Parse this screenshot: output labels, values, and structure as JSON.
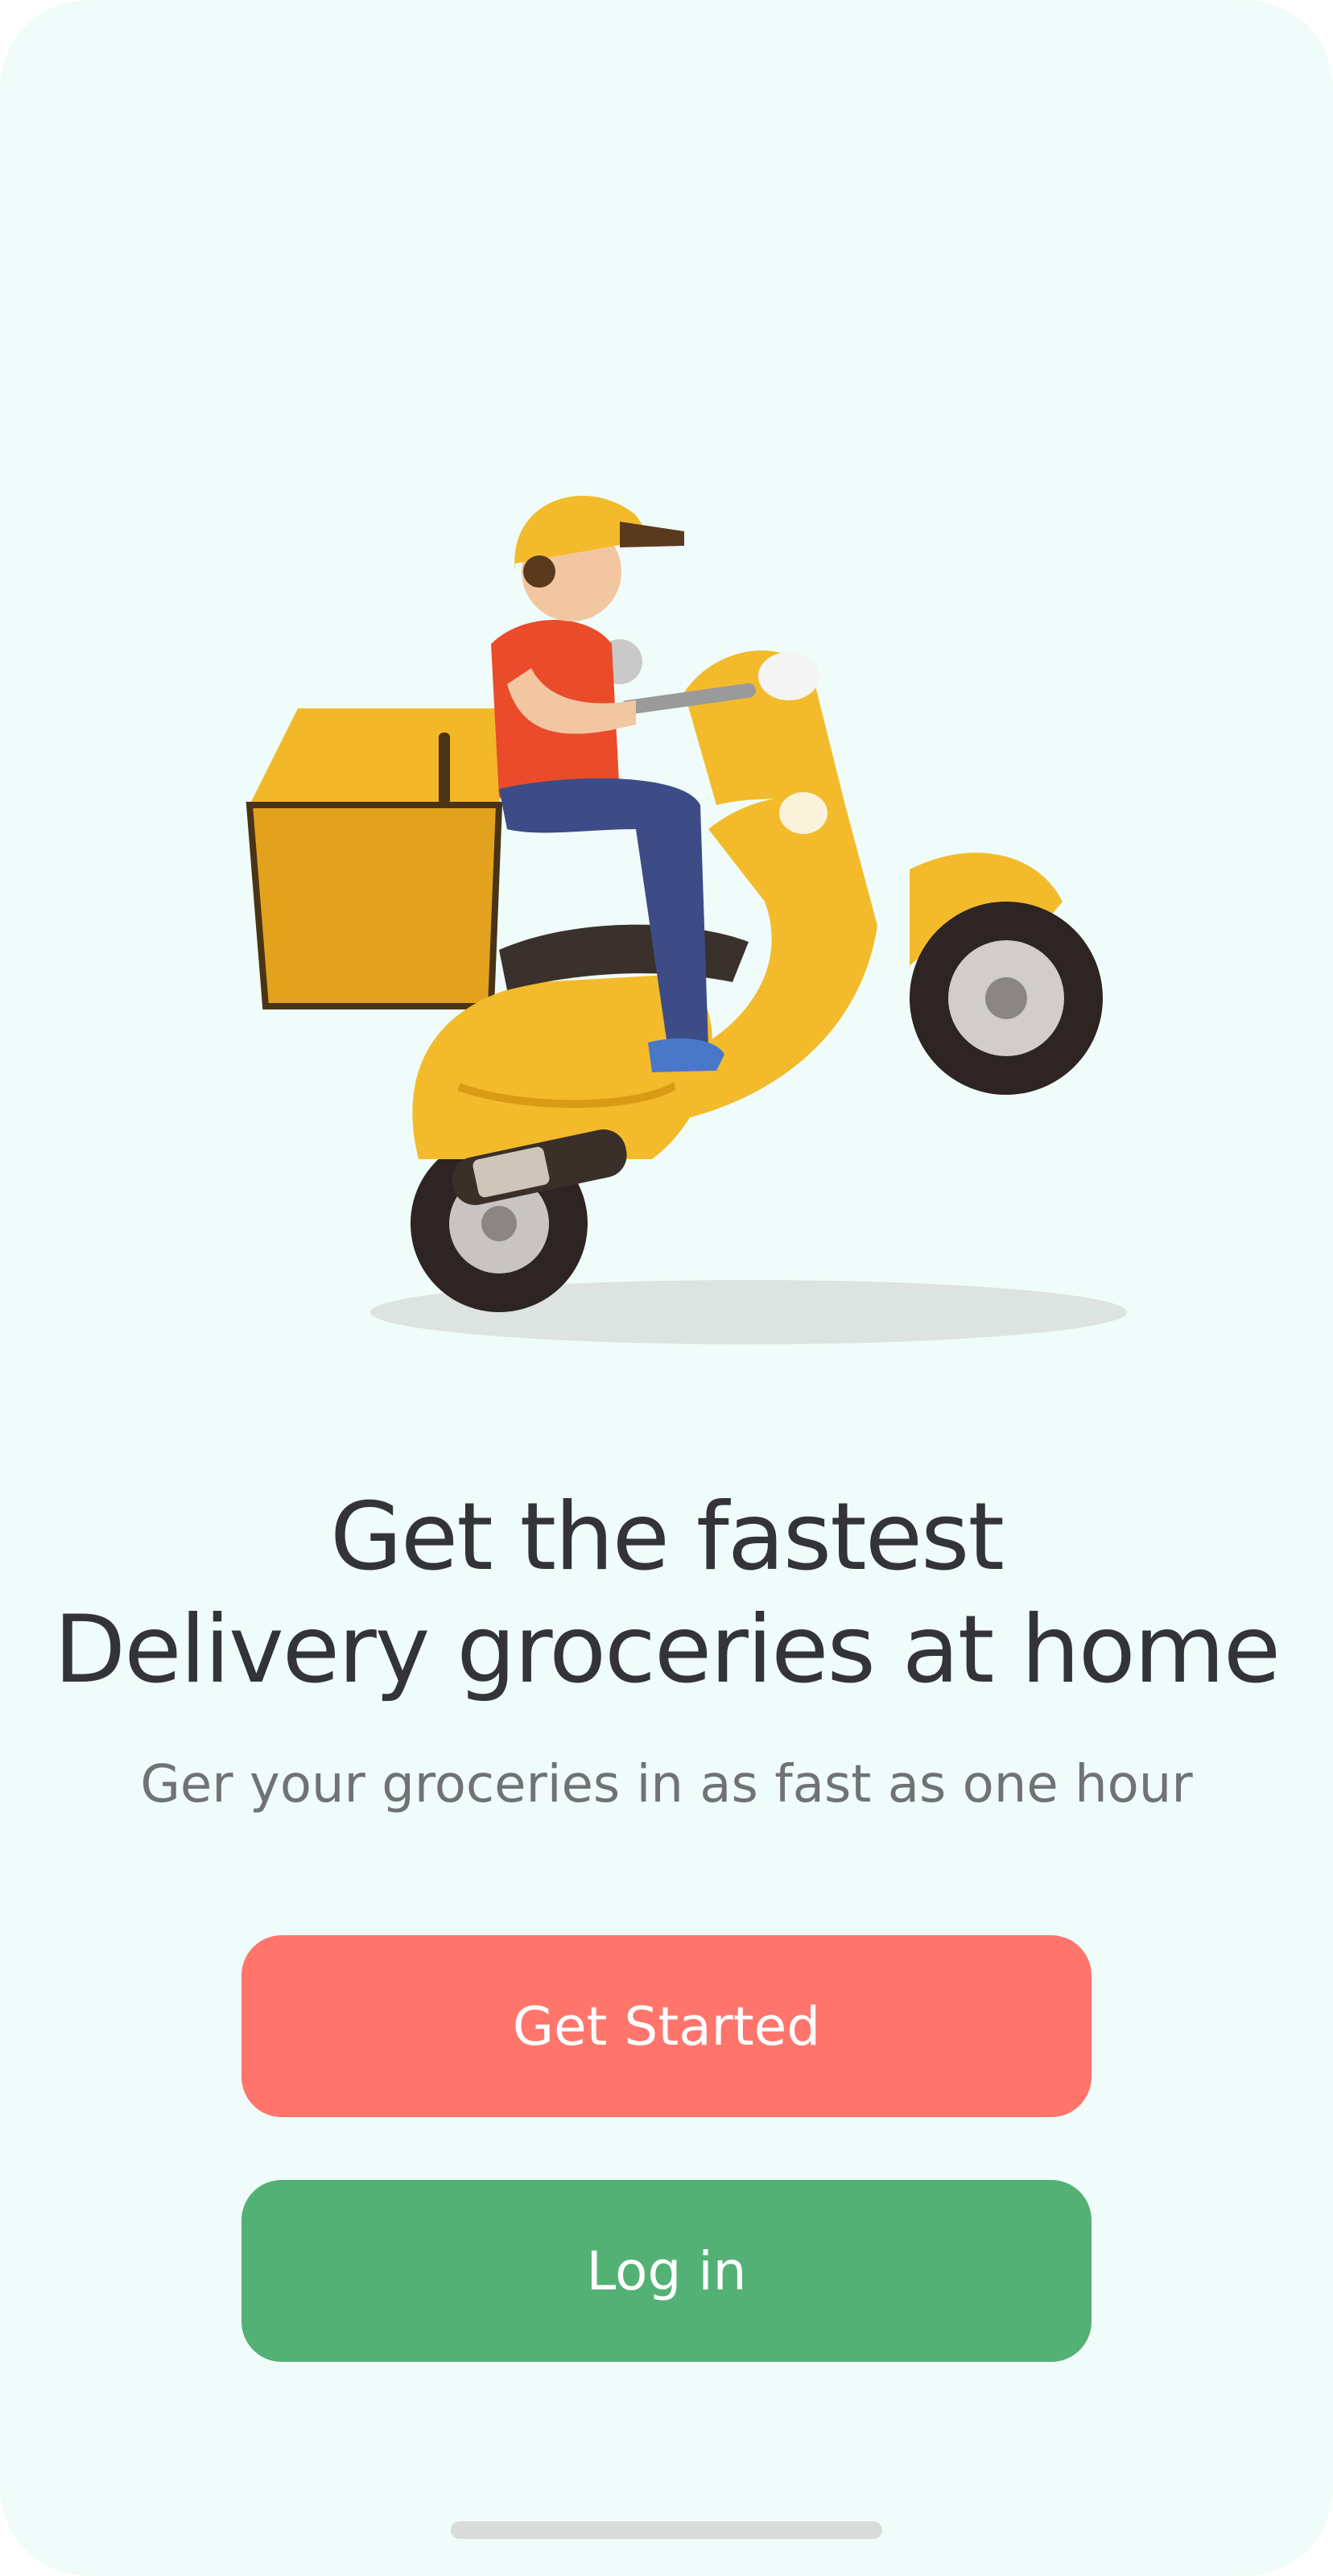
{
  "headline": {
    "line1": "Get the fastest",
    "line2": "Delivery groceries at home"
  },
  "subtitle": "Ger your groceries in as fast as one hour",
  "buttons": {
    "get_started": "Get Started",
    "login": "Log in"
  },
  "colors": {
    "background": "#f0fcf9",
    "primary_button": "#ff756b",
    "secondary_button": "#53b175",
    "headline_text": "#333437",
    "subtitle_text": "#6f7276"
  },
  "illustration": "delivery-scooter-rider-illustration"
}
